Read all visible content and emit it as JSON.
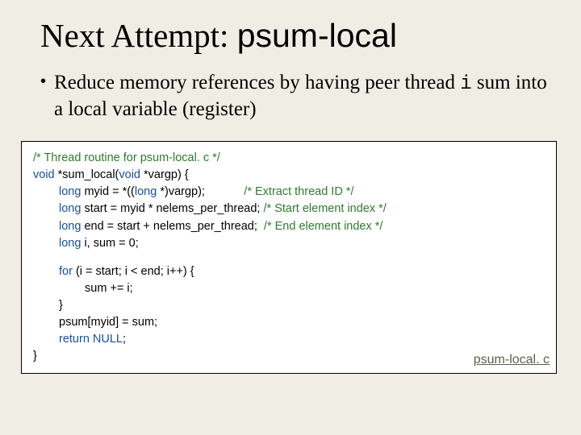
{
  "title": {
    "prefix": "Next Attempt: ",
    "code": "psum-local"
  },
  "bullet": {
    "pre": "Reduce memory references by having peer thread ",
    "var": "i",
    "post": " sum into a local variable (register)"
  },
  "code": {
    "l01_cm": "/* Thread routine for psum-local. c */",
    "l02_kw": "void",
    "l02_rest": " *sum_local(",
    "l02_kw2": "void",
    "l02_rest2": " *vargp) {",
    "l03_kw": "long",
    "l03_mid": " myid = *((",
    "l03_kw2": "long",
    "l03_rest": " *)vargp);            ",
    "l03_cm": "/* Extract thread ID */",
    "l04_kw": "long",
    "l04_rest": " start = myid * nelems_per_thread; ",
    "l04_cm": "/* Start element index */",
    "l05_kw": "long",
    "l05_rest": " end = start + nelems_per_thread;  ",
    "l05_cm": "/* End element index */",
    "l06_kw": "long",
    "l06_rest": " i, sum = 0;",
    "l07_kw": "for",
    "l07_rest": " (i = start; i < end; i++) {",
    "l08": "sum += i;",
    "l09": "}",
    "l10": "psum[myid] = sum;",
    "l11_kw": "return",
    "l11_rest": " NULL",
    "l11_semi": ";",
    "l12": "}"
  },
  "file_label": "psum-local. c"
}
